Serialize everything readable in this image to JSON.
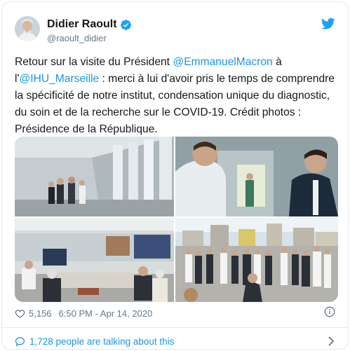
{
  "tweet": {
    "display_name": "Didier Raoult",
    "handle": "@raoult_didier",
    "text_parts": [
      "Retour sur la visite du Président ",
      "@EmmanuelMacron",
      " à l'",
      "@IHU_Marseille",
      " : merci à lui d'avoir pris le temps de comprendre la spécificité de notre institut, condensation unique du diagnostic, du soin et de la recherche sur le COVID-19. Crédit photos : Présidence de la République."
    ],
    "likes": "5,156",
    "timestamp": "6:50 PM - Apr 14, 2020",
    "talking": "1,728 people are talking about this"
  },
  "colors": {
    "link": "#1b95e0",
    "secondary": "#657786",
    "text": "#14171a",
    "border": "#e1e8ed"
  },
  "icons": [
    "verified-badge-icon",
    "twitter-bird-icon",
    "heart-icon",
    "info-icon",
    "comment-bubble-icon",
    "chevron-right-icon"
  ]
}
